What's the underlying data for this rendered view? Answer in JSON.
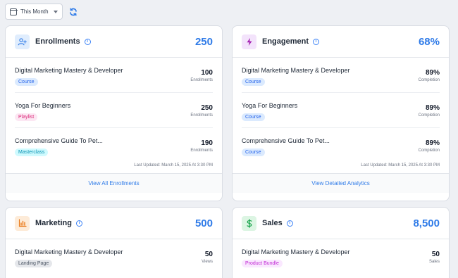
{
  "toolbar": {
    "date_range": "This Month"
  },
  "cards": [
    {
      "title": "Enrollments",
      "value": "250",
      "rows": [
        {
          "name": "Digital Marketing Mastery & Developer",
          "badge": "Course",
          "num": "100",
          "unit": "Enrollments"
        },
        {
          "name": "Yoga For Beginners",
          "badge": "Playlist",
          "num": "250",
          "unit": "Enrollments"
        },
        {
          "name": "Comprehensive Guide To Pet...",
          "badge": "Masterclass",
          "num": "190",
          "unit": "Enrollments"
        }
      ],
      "updated": "Last Updated: March 15, 2025 At 3:30 PM",
      "footer": "View All Enrollments"
    },
    {
      "title": "Engagement",
      "value": "68%",
      "rows": [
        {
          "name": "Digital Marketing Mastery & Developer",
          "badge": "Course",
          "num": "89%",
          "unit": "Completion"
        },
        {
          "name": "Yoga For Beginners",
          "badge": "Course",
          "num": "89%",
          "unit": "Completion"
        },
        {
          "name": "Comprehensive Guide To Pet...",
          "badge": "Course",
          "num": "89%",
          "unit": "Completion"
        }
      ],
      "updated": "Last Updated: March 15, 2025 At 3:30 PM",
      "footer": "View Detailed Analytics"
    },
    {
      "title": "Marketing",
      "value": "500",
      "rows": [
        {
          "name": "Digital Marketing Mastery & Developer",
          "badge": "Landing Page",
          "num": "50",
          "unit": "Views"
        }
      ]
    },
    {
      "title": "Sales",
      "value": "8,500",
      "rows": [
        {
          "name": "Digital Marketing Mastery & Developer",
          "badge": "Product Bundle",
          "num": "50",
          "unit": "Sales"
        }
      ]
    }
  ],
  "colors": {
    "accent": "#2f7be8",
    "badge_course_bg": "#dbeafe",
    "badge_course_fg": "#2563eb",
    "badge_playlist_bg": "#fce7f3",
    "badge_playlist_fg": "#db2777",
    "badge_masterclass_bg": "#cffafe",
    "badge_masterclass_fg": "#0891b2",
    "badge_landing_bg": "#e5e7eb",
    "badge_landing_fg": "#4b5563",
    "badge_bundle_bg": "#fae8ff",
    "badge_bundle_fg": "#c026d3"
  },
  "icons": [
    "calendar-icon",
    "refresh-icon",
    "user-plus-icon",
    "lightning-icon",
    "bar-chart-icon",
    "dollar-icon",
    "info-icon"
  ]
}
